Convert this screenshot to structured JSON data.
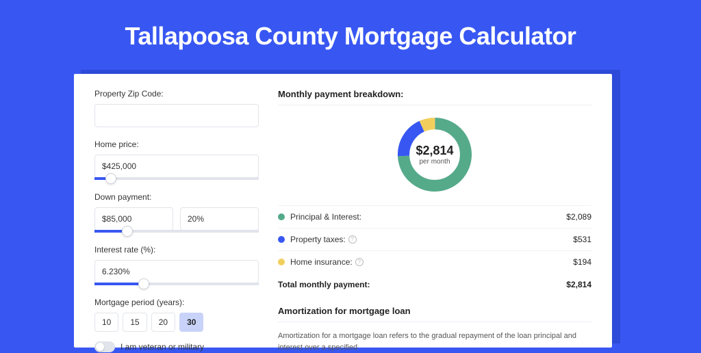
{
  "title": "Tallapoosa County Mortgage Calculator",
  "left": {
    "zip_label": "Property Zip Code:",
    "zip_value": "",
    "homeprice_label": "Home price:",
    "homeprice_value": "$425,000",
    "downpay_label": "Down payment:",
    "downpay_value": "$85,000",
    "downpay_pct": "20%",
    "rate_label": "Interest rate (%):",
    "rate_value": "6.230%",
    "period_label": "Mortgage period (years):",
    "periods": [
      "10",
      "15",
      "20",
      "30"
    ],
    "period_selected": "30",
    "veteran_label": "I am veteran or military"
  },
  "breakdown": {
    "title": "Monthly payment breakdown:",
    "center_amount": "$2,814",
    "center_sub": "per month",
    "items": [
      {
        "label": "Principal & Interest:",
        "value": "$2,089",
        "color": "#55aa8a",
        "info": false
      },
      {
        "label": "Property taxes:",
        "value": "$531",
        "color": "#3857f2",
        "info": true
      },
      {
        "label": "Home insurance:",
        "value": "$194",
        "color": "#f2cf5d",
        "info": true
      }
    ],
    "total_label": "Total monthly payment:",
    "total_value": "$2,814"
  },
  "amort": {
    "title": "Amortization for mortgage loan",
    "text": "Amortization for a mortgage loan refers to the gradual repayment of the loan principal and interest over a specified"
  },
  "chart_data": {
    "type": "pie",
    "title": "Monthly payment breakdown",
    "series": [
      {
        "name": "Principal & Interest",
        "value": 2089,
        "color": "#55aa8a"
      },
      {
        "name": "Property taxes",
        "value": 531,
        "color": "#3857f2"
      },
      {
        "name": "Home insurance",
        "value": 194,
        "color": "#f2cf5d"
      }
    ],
    "total": 2814
  }
}
